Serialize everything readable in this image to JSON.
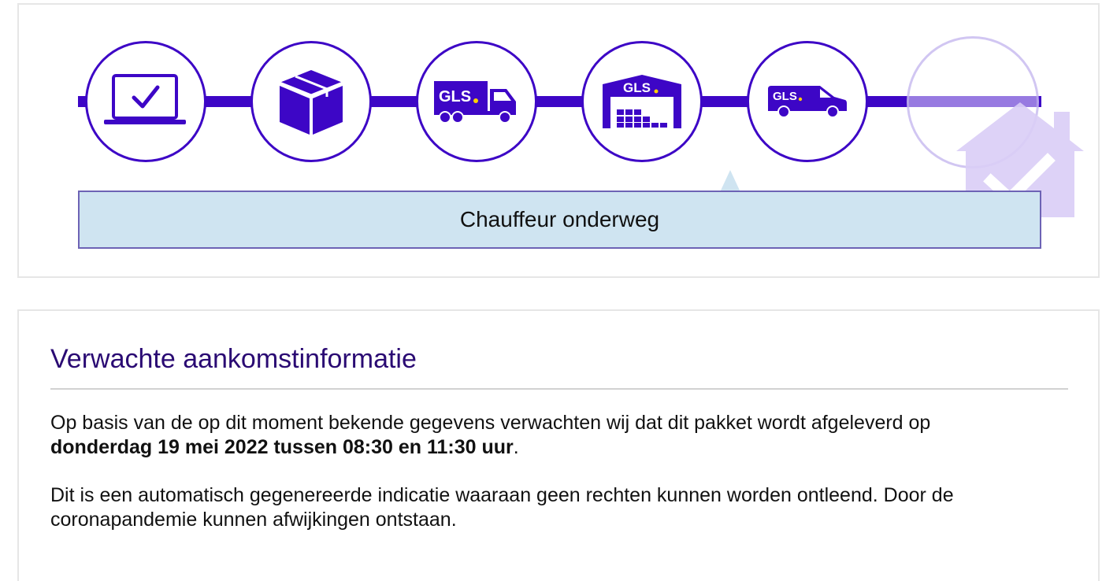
{
  "tracker": {
    "steps": [
      {
        "name": "order-received",
        "icon": "laptop-check-icon",
        "state": "done"
      },
      {
        "name": "parcel-prepared",
        "icon": "box-icon",
        "state": "done"
      },
      {
        "name": "in-transit",
        "icon": "gls-truck-icon",
        "brand": "GLS.",
        "state": "done"
      },
      {
        "name": "at-depot",
        "icon": "gls-depot-icon",
        "brand": "GLS.",
        "state": "done"
      },
      {
        "name": "out-for-delivery",
        "icon": "gls-van-icon",
        "brand": "GLS.",
        "state": "current"
      },
      {
        "name": "delivered",
        "icon": "house-check-icon",
        "state": "pending"
      }
    ],
    "status_label": "Chauffeur onderweg"
  },
  "arrival": {
    "title": "Verwachte aankomstinformatie",
    "intro": "Op basis van de op dit moment bekende gegevens verwachten wij dat dit pakket wordt afgeleverd op",
    "delivery_window": "donderdag 19 mei 2022 tussen 08:30 en 11:30 uur",
    "period": ".",
    "disclaimer": "Dit is een automatisch gegenereerde indicatie waaraan geen rechten kunnen worden ontleend. Door de coronapandemie kunnen afwijkingen ontstaan."
  },
  "colors": {
    "brand_purple": "#3d06c6",
    "status_fill": "#cfe4f1",
    "title": "#2a0a73",
    "gls_yellow": "#ffd100"
  }
}
